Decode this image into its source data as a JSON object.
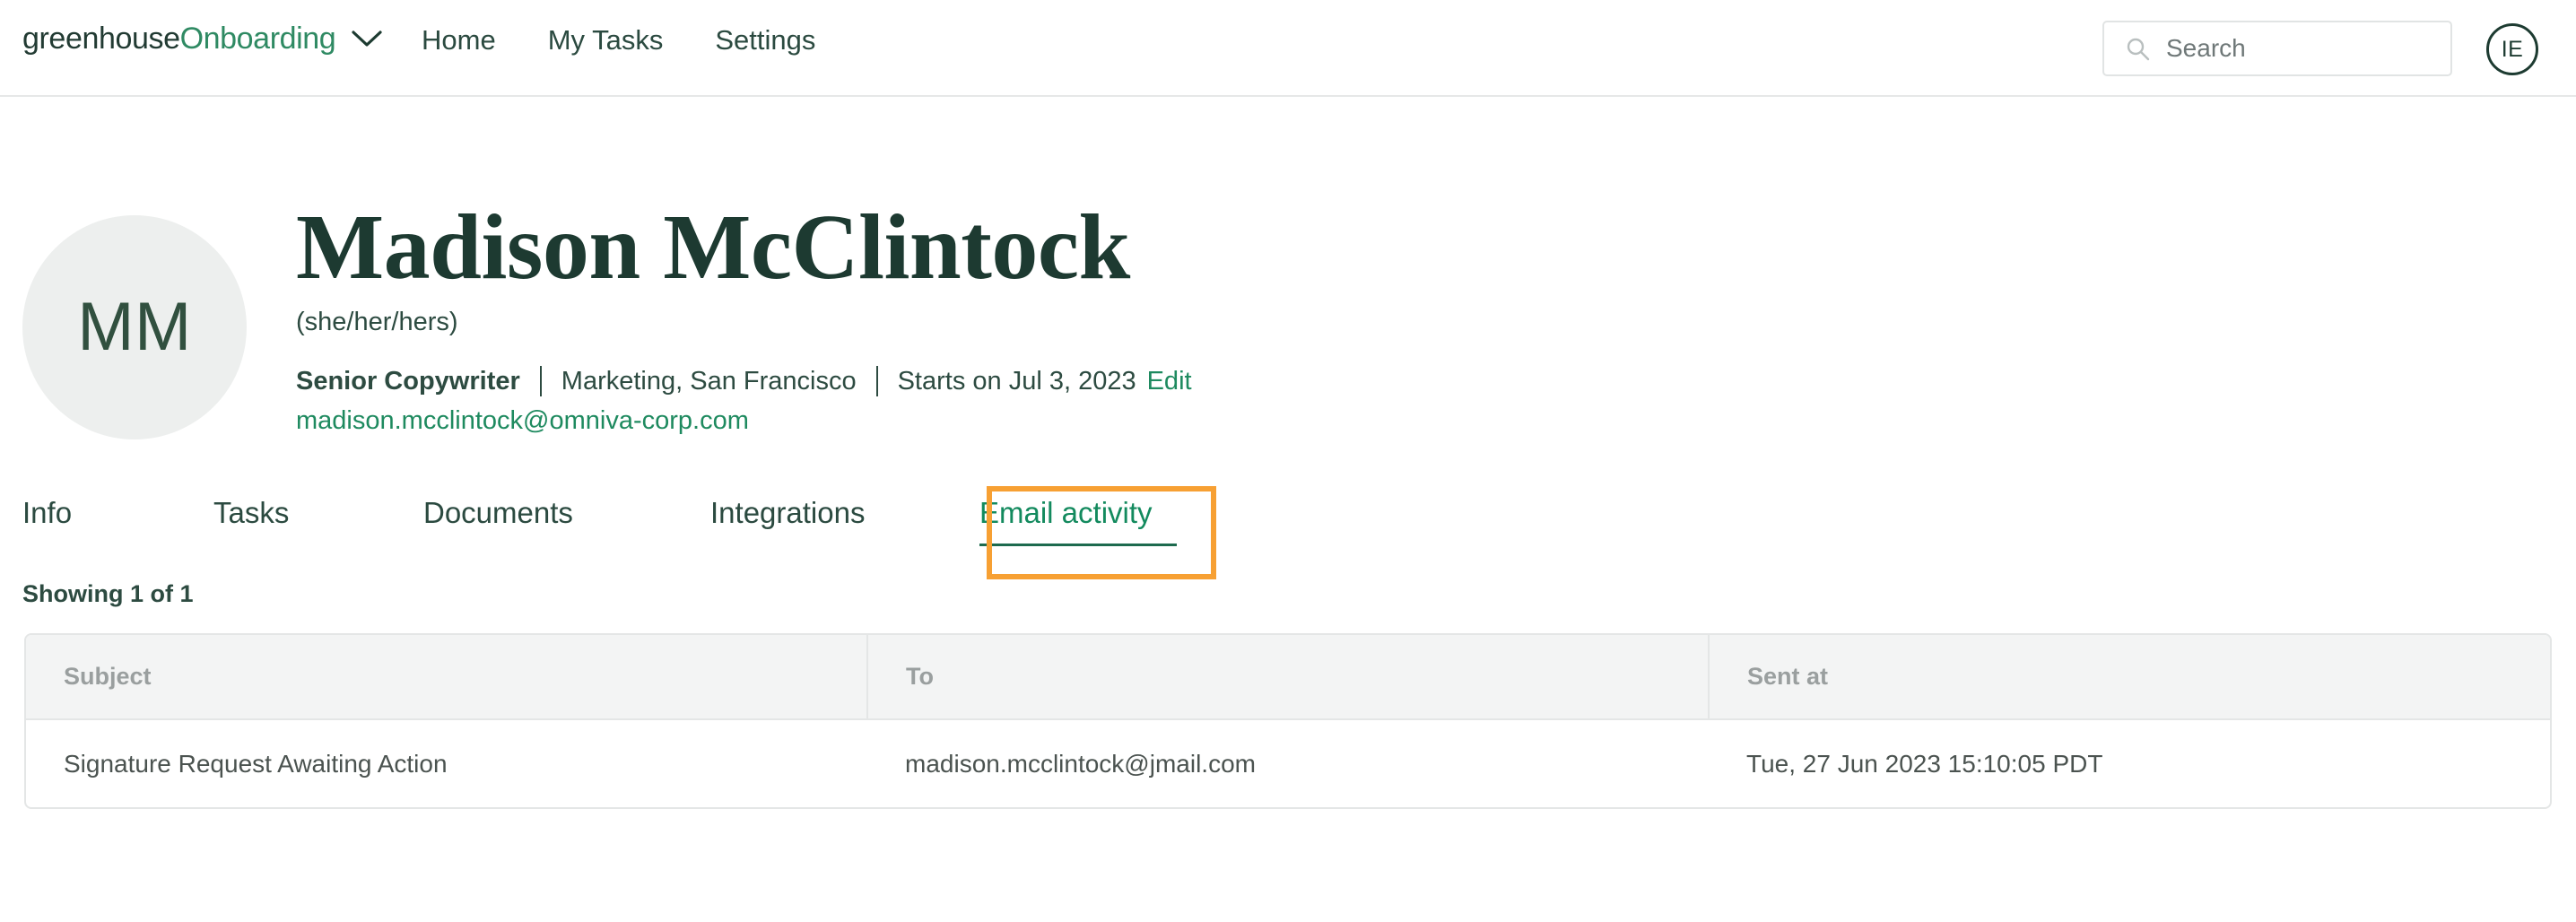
{
  "topnav": {
    "logo": {
      "word1": "greenhouse",
      "word2": "Onboarding",
      "chevron_icon": "chevron-down-icon"
    },
    "links": [
      {
        "label": "Home"
      },
      {
        "label": "My Tasks"
      },
      {
        "label": "Settings"
      }
    ],
    "search": {
      "icon": "search-icon",
      "placeholder": "Search",
      "value": ""
    },
    "user_avatar": {
      "initials": "IE"
    }
  },
  "profile": {
    "avatar_initials": "MM",
    "name": "Madison McClintock",
    "pronouns": "(she/her/hers)",
    "job_title": "Senior Copywriter",
    "department_location": "Marketing, San Francisco",
    "start_date": "Starts on Jul 3, 2023",
    "edit_label": "Edit",
    "email": "madison.mcclintock@omniva-corp.com"
  },
  "tabs": {
    "items": [
      {
        "label": "Info",
        "active": false
      },
      {
        "label": "Tasks",
        "active": false
      },
      {
        "label": "Documents",
        "active": false
      },
      {
        "label": "Integrations",
        "active": false
      },
      {
        "label": "Email activity",
        "active": true
      }
    ]
  },
  "annotation": {
    "color": "#f7a033",
    "target": "Email activity"
  },
  "email_activity": {
    "showing": "Showing 1 of 1",
    "columns": [
      "Subject",
      "To",
      "Sent at"
    ],
    "rows": [
      {
        "subject": "Signature Request Awaiting Action",
        "to": "madison.mcclintock@jmail.com",
        "sent_at": "Tue, 27 Jun 2023 15:10:05 PDT"
      }
    ]
  },
  "colors": {
    "brand_green": "#2f8a63",
    "link_green": "#1e8a5f",
    "dark_green": "#1d3a31",
    "accent_orange": "#f7a033",
    "table_header_bg": "#f3f4f4",
    "border": "#e4e6e6"
  }
}
